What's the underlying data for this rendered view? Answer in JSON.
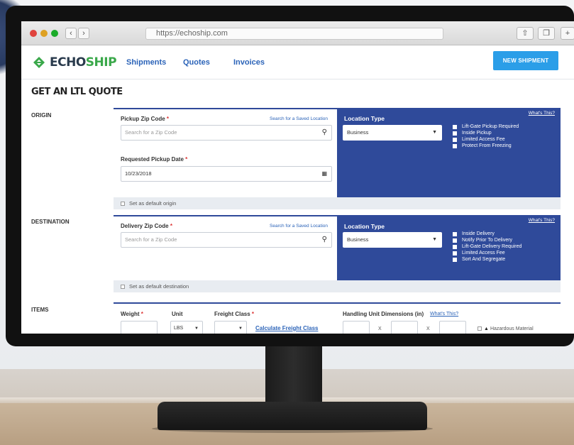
{
  "browser": {
    "url": "https://echoship.com"
  },
  "brand": {
    "echo": "ECHO",
    "ship": "SHIP"
  },
  "nav": {
    "items": [
      "Shipments",
      "Quotes",
      "Invoices"
    ],
    "new_shipment": "NEW SHIPMENT"
  },
  "page": {
    "title": "GET AN LTL QUOTE"
  },
  "origin": {
    "section_label": "ORIGIN",
    "zip_label": "Pickup Zip Code",
    "required_mark": "*",
    "saved_link": "Search for a Saved Location",
    "zip_placeholder": "Search for a Zip Code",
    "date_label": "Requested Pickup Date",
    "date_value": "10/23/2018",
    "location_type_label": "Location Type",
    "whats_this": "What's This?",
    "location_type_value": "Business",
    "options": [
      "Lift-Gate Pickup Required",
      "Inside Pickup",
      "Limited Access Fee",
      "Protect From Freezing"
    ],
    "default_label": "Set as default origin"
  },
  "destination": {
    "section_label": "DESTINATION",
    "zip_label": "Delivery Zip Code",
    "required_mark": "*",
    "saved_link": "Search for a Saved Location",
    "zip_placeholder": "Search for a Zip Code",
    "location_type_label": "Location Type",
    "whats_this": "What's This?",
    "location_type_value": "Business",
    "options": [
      "Inside Delivery",
      "Notify Prior To Delivery",
      "Lift-Gate Delivery Required",
      "Limited Access Fee",
      "Sort And Segregate"
    ],
    "default_label": "Set as default destination"
  },
  "items": {
    "section_label": "ITEMS",
    "weight_label": "Weight",
    "unit_label": "Unit",
    "freight_class_label": "Freight Class",
    "required_mark": "*",
    "unit_value": "LBS",
    "calc_link": "Calculate Freight Class",
    "dimensions_label": "Handling Unit Dimensions (in)",
    "whats_this": "What's This?",
    "x_sep": "X",
    "hazardous_label": "Hazardous Material"
  },
  "colors": {
    "accent_blue": "#2f4a9a",
    "button_blue": "#2b9ee8",
    "brand_green": "#3aa84a",
    "link_blue": "#2b63b8"
  }
}
